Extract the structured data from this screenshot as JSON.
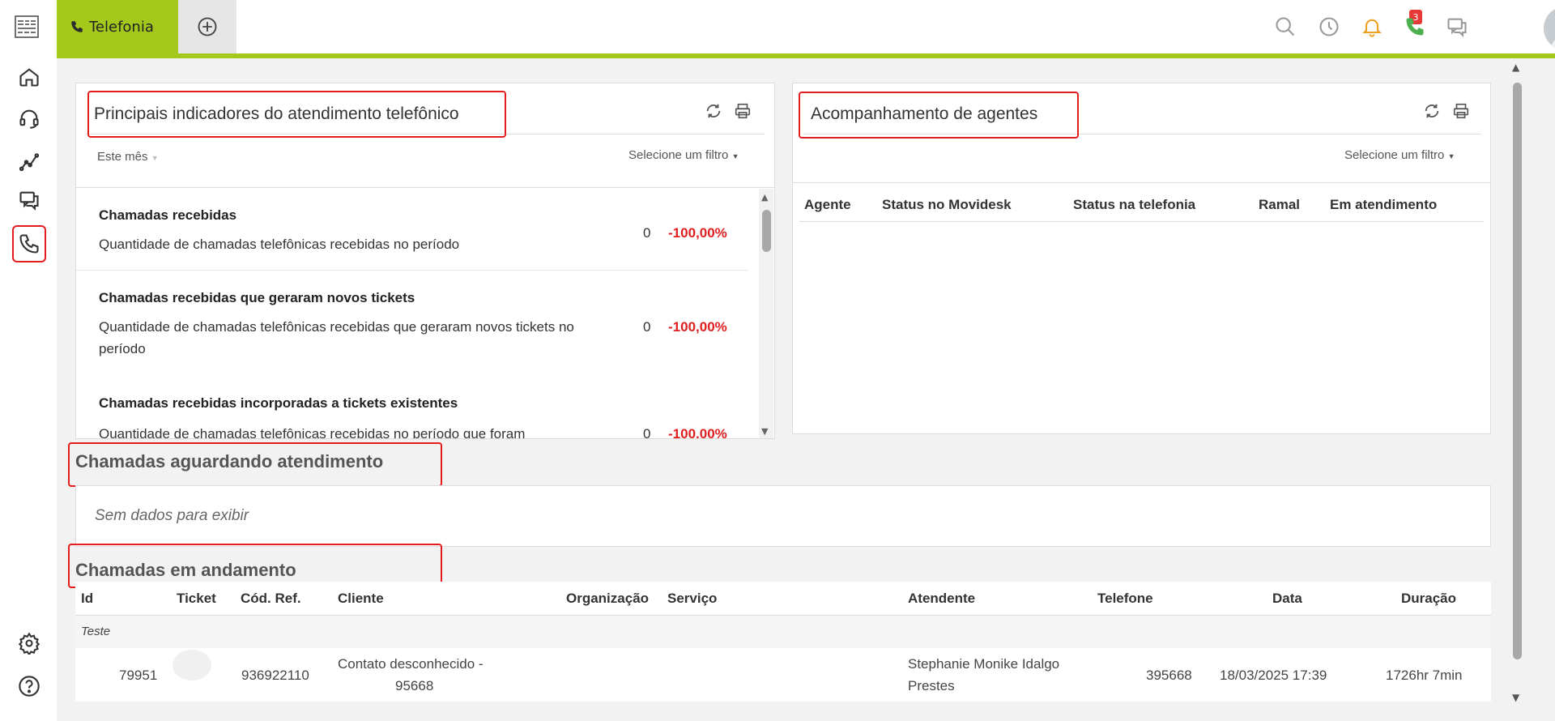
{
  "sidebar": {
    "items": [
      {
        "name": "home-icon"
      },
      {
        "name": "headset-icon"
      },
      {
        "name": "chart-icon"
      },
      {
        "name": "chat-icon"
      },
      {
        "name": "phone-icon",
        "active": true
      },
      {
        "name": "gear-icon"
      },
      {
        "name": "help-icon"
      }
    ]
  },
  "topbar": {
    "tab_label": "Telefonia",
    "notifications_count": "3",
    "icons": [
      "search-icon",
      "clock-icon",
      "bell-icon",
      "phone-icon",
      "chat-icon"
    ]
  },
  "indicators": {
    "title": "Principais indicadores do atendimento telefônico",
    "period": "Este mês",
    "filter": "Selecione um filtro",
    "rows": [
      {
        "title": "Chamadas recebidas",
        "desc": "Quantidade de chamadas telefônicas recebidas no período",
        "value": "0",
        "change": "-100,00%"
      },
      {
        "title": "Chamadas recebidas que geraram novos tickets",
        "desc": "Quantidade de chamadas telefônicas recebidas que geraram novos tickets no período",
        "value": "0",
        "change": "-100,00%"
      },
      {
        "title": "Chamadas recebidas incorporadas a tickets existentes",
        "desc": "Quantidade de chamadas telefônicas recebidas no período que foram",
        "value": "0",
        "change": "-100,00%"
      }
    ]
  },
  "agents": {
    "title": "Acompanhamento de agentes",
    "filter": "Selecione um filtro",
    "columns": [
      "Agente",
      "Status no Movidesk",
      "Status na telefonia",
      "Ramal",
      "Em atendimento"
    ]
  },
  "waiting": {
    "title": "Chamadas aguardando atendimento",
    "empty": "Sem dados para exibir"
  },
  "ongoing": {
    "title": "Chamadas em andamento",
    "columns": [
      "Id",
      "Ticket",
      "Cód. Ref.",
      "Cliente",
      "Organização",
      "Serviço",
      "Atendente",
      "Telefone",
      "Data",
      "Duração"
    ],
    "group": "Teste",
    "rows": [
      {
        "id": "79951",
        "ticket": "",
        "ref": "936922110",
        "cliente_l1": "Contato desconhecido -",
        "cliente_l2": "95668",
        "organizacao": "",
        "servico": "",
        "atendente_l1": "Stephanie Monike Idalgo",
        "atendente_l2": "Prestes",
        "telefone": "395668",
        "data": "18/03/2025 17:39",
        "duracao": "1726hr 7min"
      }
    ]
  },
  "colors": {
    "accent": "#a5c81c",
    "negative": "#e02020",
    "highlight": "#e41c1c"
  }
}
